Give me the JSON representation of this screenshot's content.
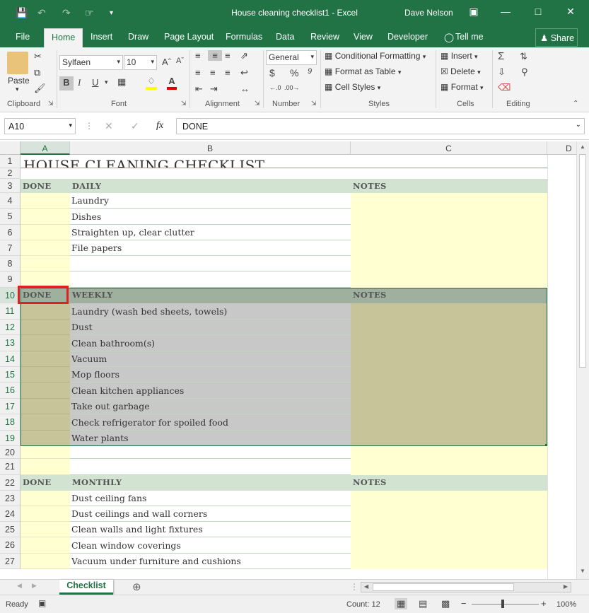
{
  "window": {
    "title": "House cleaning checklist1 - Excel",
    "user": "Dave Nelson",
    "save_icon": "save-icon",
    "undo_icon": "undo-icon",
    "redo_icon": "redo-icon",
    "touch_icon": "touch-mode-icon",
    "customize_icon": "customize-qat-icon"
  },
  "ribbon_tabs": [
    "File",
    "Home",
    "Insert",
    "Draw",
    "Page Layout",
    "Formulas",
    "Data",
    "Review",
    "View",
    "Developer",
    "Tell me"
  ],
  "share_label": "Share",
  "clipboard": {
    "paste": "Paste",
    "label": "Clipboard"
  },
  "font": {
    "name": "Sylfaen",
    "size": "10",
    "label": "Font",
    "bold": "B",
    "italic": "I",
    "underline": "U"
  },
  "alignment": {
    "label": "Alignment"
  },
  "number": {
    "format": "General",
    "label": "Number",
    "currency": "$",
    "percent": "%",
    "comma": "9"
  },
  "styles": {
    "conditional": "Conditional Formatting",
    "table": "Format as Table",
    "cell_styles": "Cell Styles",
    "label": "Styles"
  },
  "cells": {
    "insert": "Insert",
    "delete": "Delete",
    "format": "Format",
    "label": "Cells"
  },
  "editing": {
    "label": "Editing"
  },
  "formula_bar": {
    "name_box": "A10",
    "fx": "fx",
    "value": "DONE"
  },
  "columns": [
    "A",
    "B",
    "C",
    "D"
  ],
  "rows": [
    "1",
    "2",
    "3",
    "4",
    "5",
    "6",
    "7",
    "8",
    "9",
    "10",
    "11",
    "12",
    "13",
    "14",
    "15",
    "16",
    "17",
    "18",
    "19",
    "20",
    "21",
    "22",
    "23",
    "24",
    "25",
    "26",
    "27"
  ],
  "sheet": {
    "title": "HOUSE CLEANING CHECKLIST",
    "daily": {
      "done": "DONE",
      "heading": "DAILY",
      "notes": "NOTES",
      "items": [
        "Laundry",
        "Dishes",
        "Straighten up, clear clutter",
        "File papers"
      ]
    },
    "weekly": {
      "done": "DONE",
      "heading": "WEEKLY",
      "notes": "NOTES",
      "items": [
        "Laundry (wash bed sheets, towels)",
        "Dust",
        "Clean bathroom(s)",
        "Vacuum",
        "Mop floors",
        "Clean kitchen appliances",
        "Take out garbage",
        "Check refrigerator for spoiled food",
        "Water plants"
      ]
    },
    "monthly": {
      "done": "DONE",
      "heading": "MONTHLY",
      "notes": "NOTES",
      "items": [
        "Dust ceiling fans",
        "Dust ceilings and wall corners",
        "Clean walls and light fixtures",
        "Clean window coverings",
        "Vacuum under furniture and cushions"
      ]
    }
  },
  "sheet_tab": "Checklist",
  "status": {
    "ready": "Ready",
    "count": "Count: 12",
    "zoom": "100%"
  },
  "colors": {
    "excel_green": "#217346",
    "header_green": "#d2e3d2",
    "done_yellow": "#ffffd2",
    "selected_gray": "#c8c8c8",
    "selected_olive": "#c8c49a",
    "selection_red": "#e02020"
  }
}
